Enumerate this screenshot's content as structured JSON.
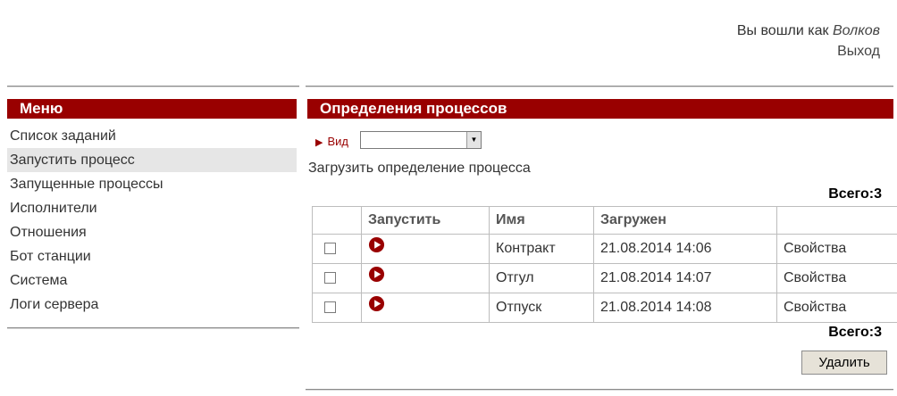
{
  "header": {
    "logged_in_as": "Вы вошли как",
    "user": "Волков",
    "logout": "Выход"
  },
  "sidebar": {
    "title": "Меню",
    "items": [
      {
        "label": "Список заданий"
      },
      {
        "label": "Запустить процесс"
      },
      {
        "label": "Запущенные процессы"
      },
      {
        "label": "Исполнители"
      },
      {
        "label": "Отношения"
      },
      {
        "label": "Бот станции"
      },
      {
        "label": "Система"
      },
      {
        "label": "Логи сервера"
      }
    ],
    "active_index": 1
  },
  "main": {
    "title": "Определения процессов",
    "view_label": "Вид",
    "view_value": "",
    "upload_link": "Загрузить определение процесса",
    "total_label": "Всего:",
    "total_count": "3",
    "columns": [
      "",
      "Запустить",
      "Имя",
      "Загружен",
      ""
    ],
    "rows": [
      {
        "name": "Контракт",
        "uploaded": "21.08.2014 14:06",
        "props": "Свойства"
      },
      {
        "name": "Отгул",
        "uploaded": "21.08.2014 14:07",
        "props": "Свойства"
      },
      {
        "name": "Отпуск",
        "uploaded": "21.08.2014 14:08",
        "props": "Свойства"
      }
    ],
    "delete_button": "Удалить"
  },
  "colors": {
    "accent": "#990000",
    "active_item_bg": "#e6e6e6"
  },
  "icons": {
    "start": "play-circle-icon",
    "view_marker": "triangle-right-icon",
    "select_arrow": "chevron-down-icon"
  }
}
